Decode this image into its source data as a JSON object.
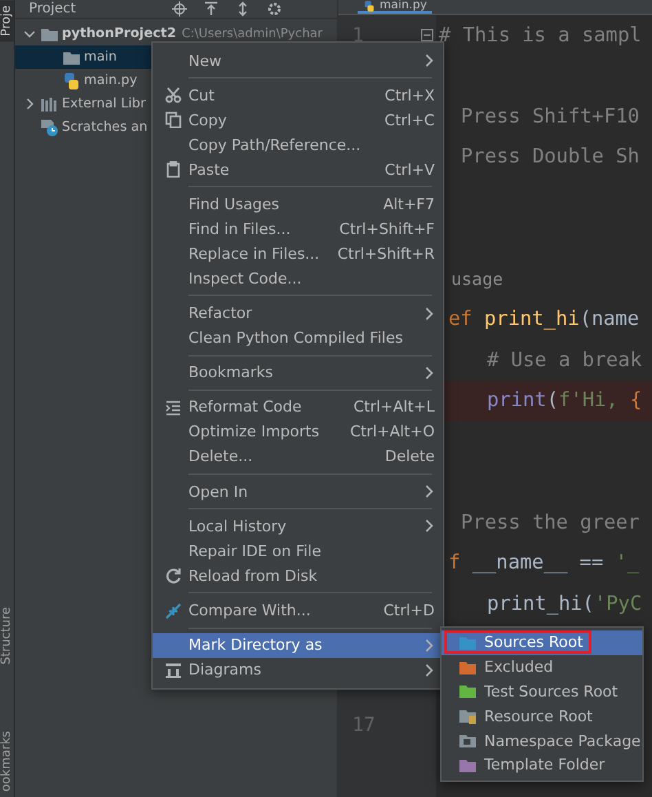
{
  "tool_stripe": [
    {
      "label": "Proje",
      "selected": true
    },
    {
      "label": "Structure",
      "selected": false
    },
    {
      "label": "ookmarks",
      "selected": false
    }
  ],
  "project_panel": {
    "title": "Project",
    "tree": [
      {
        "kind": "project",
        "label": "pythonProject2",
        "path": "C:\\Users\\admin\\Pychar",
        "expanded": true,
        "selected": false,
        "children": [
          {
            "kind": "folder",
            "label": "main",
            "selected": true
          },
          {
            "kind": "file",
            "label": "main.py",
            "selected": false
          }
        ]
      },
      {
        "kind": "library",
        "label": "External Libr",
        "expanded": false,
        "selected": false
      },
      {
        "kind": "scratches",
        "label": "Scratches an",
        "selected": false
      }
    ]
  },
  "editor": {
    "tabs": [
      {
        "label": "main.py",
        "selected": true
      }
    ],
    "lines": [
      {
        "kind": "header",
        "number": "1",
        "fold": true,
        "breakpoint": false,
        "segments": [
          {
            "kind": "comment",
            "text": "# This is a sampl"
          }
        ]
      },
      {
        "kind": "blank"
      },
      {
        "kind": "comment",
        "breakpoint": false,
        "segments": [
          {
            "kind": "comment",
            "text": "Press Shift+F10"
          }
        ]
      },
      {
        "kind": "comment",
        "breakpoint": false,
        "segments": [
          {
            "kind": "comment",
            "text": "Press Double Sh"
          }
        ]
      },
      {
        "kind": "blank"
      },
      {
        "kind": "blank"
      },
      {
        "kind": "hint",
        "segments": [
          {
            "kind": "hint",
            "text": "usage"
          }
        ]
      },
      {
        "kind": "code",
        "breakpoint": false,
        "segments": [
          {
            "kind": "keyword",
            "text": "ef"
          },
          {
            "kind": "function",
            "text": " print_hi"
          },
          {
            "kind": "plain",
            "text": "(name"
          }
        ]
      },
      {
        "kind": "body",
        "breakpoint": false,
        "segments": [
          {
            "kind": "comment",
            "text": "# Use a break"
          }
        ]
      },
      {
        "kind": "body",
        "breakpoint": true,
        "segments": [
          {
            "kind": "builtin",
            "text": "print"
          },
          {
            "kind": "plain",
            "text": "("
          },
          {
            "kind": "string",
            "text": "f'Hi, "
          },
          {
            "kind": "keyword",
            "text": "{"
          }
        ]
      },
      {
        "kind": "blank"
      },
      {
        "kind": "blank"
      },
      {
        "kind": "comment",
        "breakpoint": false,
        "segments": [
          {
            "kind": "comment",
            "text": "Press the greer"
          }
        ]
      },
      {
        "kind": "code",
        "breakpoint": false,
        "segments": [
          {
            "kind": "keyword",
            "text": "f"
          },
          {
            "kind": "plain",
            "text": " __name__ == "
          },
          {
            "kind": "string",
            "text": "'_"
          }
        ]
      },
      {
        "kind": "body",
        "breakpoint": false,
        "segments": [
          {
            "kind": "plain",
            "text": "print_hi("
          },
          {
            "kind": "string",
            "text": "'PyC"
          }
        ]
      },
      {
        "kind": "blank"
      },
      {
        "kind": "blank"
      },
      {
        "kind": "blank",
        "number": "17"
      }
    ]
  },
  "context_menu": {
    "items": [
      {
        "kind": "plain",
        "label": "New",
        "submenu": true,
        "selected": false
      },
      {
        "kind": "separator"
      },
      {
        "kind": "cut",
        "label": "Cut",
        "shortcut": "Ctrl+X",
        "submenu": false,
        "selected": false
      },
      {
        "kind": "copy",
        "label": "Copy",
        "shortcut": "Ctrl+C",
        "submenu": false,
        "selected": false
      },
      {
        "kind": "plain",
        "label": "Copy Path/Reference...",
        "submenu": false,
        "selected": false
      },
      {
        "kind": "paste",
        "label": "Paste",
        "shortcut": "Ctrl+V",
        "submenu": false,
        "selected": false
      },
      {
        "kind": "separator"
      },
      {
        "kind": "plain",
        "label": "Find Usages",
        "shortcut": "Alt+F7",
        "submenu": false,
        "selected": false
      },
      {
        "kind": "plain",
        "label": "Find in Files...",
        "shortcut": "Ctrl+Shift+F",
        "submenu": false,
        "selected": false
      },
      {
        "kind": "plain",
        "label": "Replace in Files...",
        "shortcut": "Ctrl+Shift+R",
        "submenu": false,
        "selected": false
      },
      {
        "kind": "plain",
        "label": "Inspect Code...",
        "submenu": false,
        "selected": false
      },
      {
        "kind": "separator"
      },
      {
        "kind": "plain",
        "label": "Refactor",
        "submenu": true,
        "selected": false
      },
      {
        "kind": "plain",
        "label": "Clean Python Compiled Files",
        "submenu": false,
        "selected": false
      },
      {
        "kind": "separator"
      },
      {
        "kind": "plain",
        "label": "Bookmarks",
        "submenu": true,
        "selected": false
      },
      {
        "kind": "separator"
      },
      {
        "kind": "reformat",
        "label": "Reformat Code",
        "shortcut": "Ctrl+Alt+L",
        "submenu": false,
        "selected": false
      },
      {
        "kind": "plain",
        "label": "Optimize Imports",
        "shortcut": "Ctrl+Alt+O",
        "submenu": false,
        "selected": false
      },
      {
        "kind": "plain",
        "label": "Delete...",
        "shortcut": "Delete",
        "submenu": false,
        "selected": false
      },
      {
        "kind": "separator"
      },
      {
        "kind": "plain",
        "label": "Open In",
        "submenu": true,
        "selected": false
      },
      {
        "kind": "separator"
      },
      {
        "kind": "plain",
        "label": "Local History",
        "submenu": true,
        "selected": false
      },
      {
        "kind": "plain",
        "label": "Repair IDE on File",
        "submenu": false,
        "selected": false
      },
      {
        "kind": "reload",
        "label": "Reload from Disk",
        "submenu": false,
        "selected": false
      },
      {
        "kind": "separator"
      },
      {
        "kind": "compare",
        "label": "Compare With...",
        "shortcut": "Ctrl+D",
        "submenu": false,
        "selected": false
      },
      {
        "kind": "separator"
      },
      {
        "kind": "plain",
        "label": "Mark Directory as",
        "submenu": true,
        "selected": true
      },
      {
        "kind": "diagrams",
        "label": "Diagrams",
        "submenu": true,
        "selected": false
      }
    ]
  },
  "submenu": {
    "items": [
      {
        "label": "Sources Root",
        "kind": "plain",
        "color": "#3592c4",
        "selected": true,
        "highlighted": true
      },
      {
        "label": "Excluded",
        "kind": "plain",
        "color": "#d46a30",
        "selected": false,
        "highlighted": false
      },
      {
        "label": "Test Sources Root",
        "kind": "plain",
        "color": "#62b543",
        "selected": false,
        "highlighted": false
      },
      {
        "label": "Resource Root",
        "kind": "resource",
        "color": "#87939a",
        "selected": false,
        "highlighted": false
      },
      {
        "label": "Namespace Package",
        "kind": "namespace",
        "color": "#87939a",
        "selected": false,
        "highlighted": false
      },
      {
        "label": "Template Folder",
        "kind": "plain",
        "color": "#9876aa",
        "selected": false,
        "highlighted": false
      }
    ]
  }
}
